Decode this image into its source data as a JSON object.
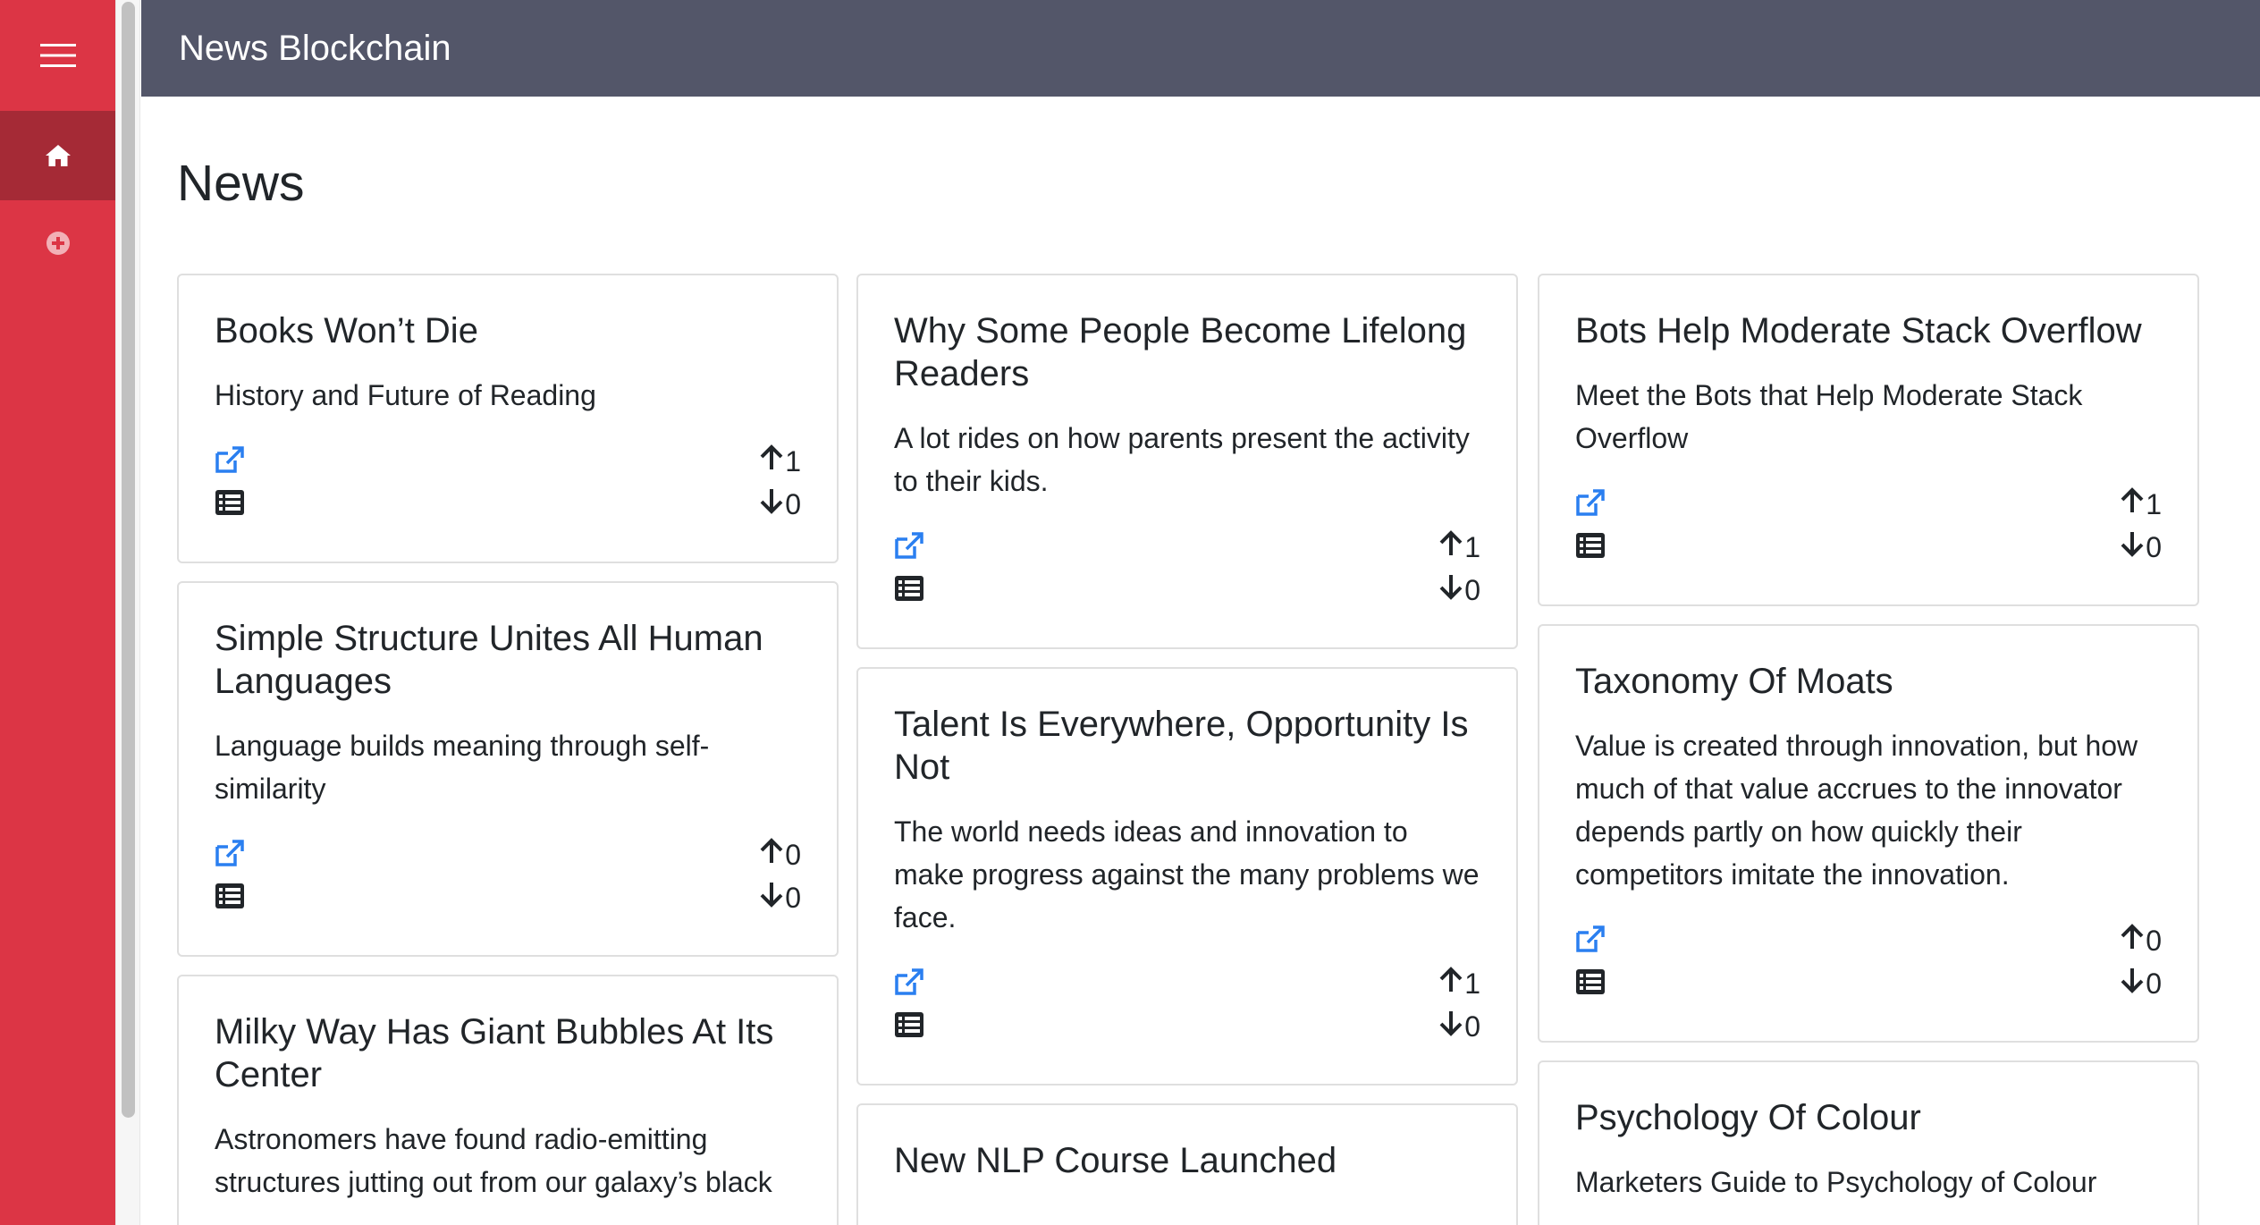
{
  "header": {
    "title": "News Blockchain"
  },
  "sidebar": {
    "items": [
      {
        "icon": "hamburger-menu-icon"
      },
      {
        "icon": "home-icon",
        "active": true
      },
      {
        "icon": "plus-circle-icon"
      }
    ]
  },
  "page": {
    "title": "News"
  },
  "colors": {
    "sidebar": "#dc3545",
    "sidebar_active": "#a52a36",
    "header": "#535669",
    "link": "#2a7ff0"
  },
  "columns": [
    {
      "cards": [
        {
          "title": "Books Won’t Die",
          "description": "History and Future of Reading",
          "upvotes": "1",
          "downvotes": "0"
        },
        {
          "title": "Simple Structure Unites All Human Languages",
          "description": "Language builds meaning through self-similarity",
          "upvotes": "0",
          "downvotes": "0"
        },
        {
          "title": "Milky Way Has Giant Bubbles At Its Center",
          "description": "Astronomers have found radio-emitting structures jutting out from our galaxy’s black",
          "upvotes": "",
          "downvotes": ""
        }
      ]
    },
    {
      "cards": [
        {
          "title": "Why Some People Become Lifelong Readers",
          "description": "A lot rides on how parents present the activity to their kids.",
          "upvotes": "1",
          "downvotes": "0"
        },
        {
          "title": "Talent Is Everywhere, Opportunity Is Not",
          "description": "The world needs ideas and innovation to make progress against the many problems we face.",
          "upvotes": "1",
          "downvotes": "0"
        },
        {
          "title": "New NLP Course Launched",
          "description": "",
          "upvotes": "",
          "downvotes": ""
        }
      ]
    },
    {
      "cards": [
        {
          "title": "Bots Help Moderate Stack Overflow",
          "description": "Meet the Bots that Help Moderate Stack Overflow",
          "upvotes": "1",
          "downvotes": "0"
        },
        {
          "title": "Taxonomy Of Moats",
          "description": "Value is created through innovation, but how much of that value accrues to the innovator depends partly on how quickly their competitors imitate the innovation.",
          "upvotes": "0",
          "downvotes": "0"
        },
        {
          "title": "Psychology Of Colour",
          "description": "Marketers Guide to Psychology of Colour",
          "upvotes": "",
          "downvotes": ""
        }
      ]
    }
  ]
}
